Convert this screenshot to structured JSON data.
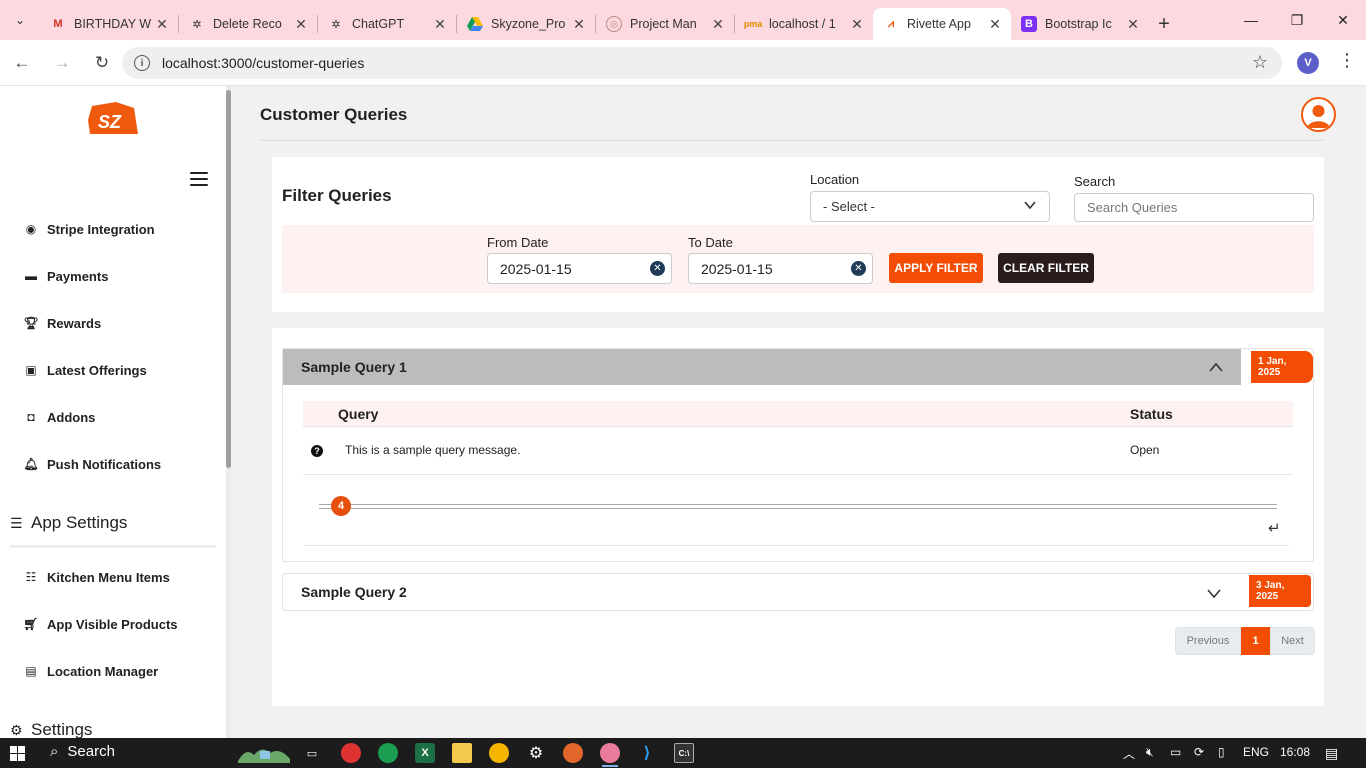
{
  "browser": {
    "tabs": [
      {
        "label": "BIRTHDAY W",
        "icon": "gmail-icon"
      },
      {
        "label": "Delete Reco",
        "icon": "chatgpt-icon"
      },
      {
        "label": "ChatGPT",
        "icon": "chatgpt-icon"
      },
      {
        "label": "Skyzone_Pro",
        "icon": "google-drive-icon"
      },
      {
        "label": "Project Man",
        "icon": "project-icon"
      },
      {
        "label": "localhost / 1",
        "icon": "phpmyadmin-icon"
      },
      {
        "label": "Rivette App",
        "icon": "rivette-icon",
        "active": true
      },
      {
        "label": "Bootstrap Ic",
        "icon": "bootstrap-icon"
      }
    ],
    "url": "localhost:3000/customer-queries",
    "profile_initial": "V"
  },
  "sidebar": {
    "logo_text": "SZ",
    "items_top": [
      {
        "label": "Stripe Integration",
        "icon": "stripe-icon"
      },
      {
        "label": "Payments",
        "icon": "credit-card-icon"
      },
      {
        "label": "Rewards",
        "icon": "trophy-icon"
      },
      {
        "label": "Latest Offerings",
        "icon": "gift-icon"
      },
      {
        "label": "Addons",
        "icon": "bag-icon"
      },
      {
        "label": "Push Notifications",
        "icon": "bell-icon"
      }
    ],
    "section_app_settings": "App Settings",
    "items_app": [
      {
        "label": "Kitchen Menu Items",
        "icon": "list-icon"
      },
      {
        "label": "App Visible Products",
        "icon": "cart-icon"
      },
      {
        "label": "Location Manager",
        "icon": "person-badge-icon"
      }
    ],
    "section_settings": "Settings"
  },
  "header": {
    "title": "Customer Queries"
  },
  "filters": {
    "title": "Filter Queries",
    "location_label": "Location",
    "location_value": "- Select -",
    "search_label": "Search",
    "search_placeholder": "Search Queries",
    "from_label": "From Date",
    "from_value": "2025-01-15",
    "to_label": "To Date",
    "to_value": "2025-01-15",
    "apply_label": "APPLY FILTER",
    "clear_label": "CLEAR FILTER"
  },
  "queries": [
    {
      "title": "Sample Query 1",
      "date_line1": "1 Jan,",
      "date_line2": "2025",
      "expanded": true,
      "col_query": "Query",
      "col_status": "Status",
      "message": "This is a sample query message.",
      "status": "Open",
      "reply_count": "4"
    },
    {
      "title": "Sample Query 2",
      "date_line1": "3 Jan,",
      "date_line2": "2025",
      "expanded": false
    }
  ],
  "pagination": {
    "prev": "Previous",
    "current": "1",
    "next": "Next"
  },
  "taskbar": {
    "search": "Search",
    "lang": "ENG",
    "time": "16:08"
  },
  "colors": {
    "accent": "#f34d04",
    "dark_button": "#2a1c1c",
    "tab_strip": "#fbd9de"
  }
}
